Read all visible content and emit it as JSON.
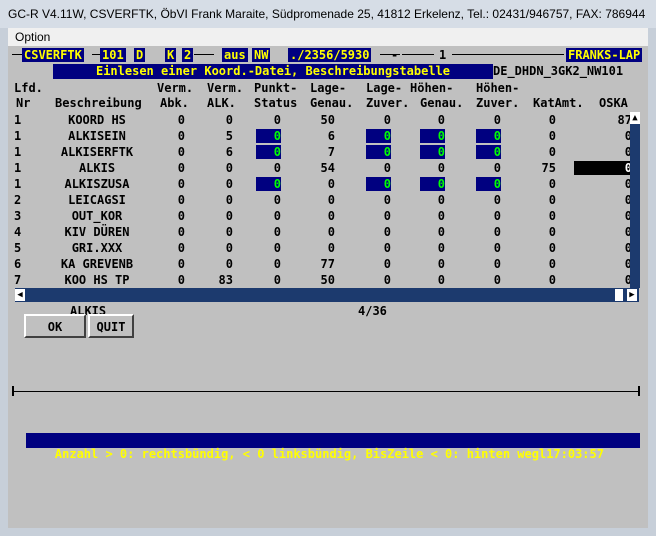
{
  "window": {
    "title": "GC-R V4.11W, CSVERFTK, ÖbVI Frank Maraite, Südpromenade 25, 41812 Erkelenz, Tel.: 02431/946757, FAX: 786944"
  },
  "menu": {
    "option": "Option"
  },
  "topbar": {
    "prog": "CSVERFTK",
    "num": "101",
    "flag1": "D",
    "flag2": "K",
    "flag3": "2",
    "mode": "aus",
    "region": "NW",
    "ref": "./2356/5930",
    "dash": "-",
    "page": "1",
    "user": "FRANKS-LAP"
  },
  "banner": {
    "title": "Einlesen einer Koord.-Datei, Beschreibungstabelle",
    "file": "DE_DHDN_3GK2_NW101"
  },
  "table": {
    "headers_line1": [
      "Lfd.",
      "",
      "Verm.",
      "Verm.",
      "Punkt-",
      "Lage-",
      "Lage-",
      "Höhen-",
      "Höhen-",
      "",
      ""
    ],
    "headers_line2": [
      "Nr",
      "Beschreibung",
      "Abk.",
      "ALK.",
      "Status",
      "Genau.",
      "Zuver.",
      "Genau.",
      "Zuver.",
      "KatAmt.",
      "OSKA"
    ],
    "rows": [
      {
        "nr": "1",
        "desc": "KOORD HS",
        "c": [
          "0",
          "0",
          "0",
          "50",
          "0",
          "0",
          "0",
          "0",
          "87"
        ]
      },
      {
        "nr": "1",
        "desc": "ALKISEIN",
        "c": [
          "0",
          "5",
          "0",
          "6",
          "0",
          "0",
          "0",
          "0",
          "0"
        ]
      },
      {
        "nr": "1",
        "desc": "ALKISERFTK",
        "c": [
          "0",
          "6",
          "0",
          "7",
          "0",
          "0",
          "0",
          "0",
          "0"
        ]
      },
      {
        "nr": "1",
        "desc": "ALKIS",
        "c": [
          "0",
          "0",
          "0",
          "54",
          "0",
          "0",
          "0",
          "75",
          "0"
        ]
      },
      {
        "nr": "1",
        "desc": "ALKISZUSA",
        "c": [
          "0",
          "0",
          "0",
          "0",
          "0",
          "0",
          "0",
          "0",
          "0"
        ]
      },
      {
        "nr": "2",
        "desc": "LEICAGSI",
        "c": [
          "0",
          "0",
          "0",
          "0",
          "0",
          "0",
          "0",
          "0",
          "0"
        ]
      },
      {
        "nr": "3",
        "desc": "OUT_KOR",
        "c": [
          "0",
          "0",
          "0",
          "0",
          "0",
          "0",
          "0",
          "0",
          "0"
        ]
      },
      {
        "nr": "4",
        "desc": "KIV DÜREN",
        "c": [
          "0",
          "0",
          "0",
          "0",
          "0",
          "0",
          "0",
          "0",
          "0"
        ]
      },
      {
        "nr": "5",
        "desc": "GRI.XXX",
        "c": [
          "0",
          "0",
          "0",
          "0",
          "0",
          "0",
          "0",
          "0",
          "0"
        ]
      },
      {
        "nr": "6",
        "desc": "KA GREVENB",
        "c": [
          "0",
          "0",
          "0",
          "77",
          "0",
          "0",
          "0",
          "0",
          "0"
        ]
      },
      {
        "nr": "7",
        "desc": "KOO HS TP",
        "c": [
          "0",
          "83",
          "0",
          "50",
          "0",
          "0",
          "0",
          "0",
          "0"
        ]
      }
    ]
  },
  "selection": {
    "name": "ALKIS",
    "position": "4/36"
  },
  "buttons": {
    "ok": "OK",
    "quit": "QUIT"
  },
  "status": {
    "message": "Anzahl > 0: rechtsbündig, < 0 linksbündig, BisZeile < 0: hinten wegl",
    "time": "17:03:57"
  },
  "colors": {
    "field_bg": "#000080",
    "field_fg": "#ffff00",
    "highlight_fg": "#00ff00",
    "window_bg": "#c0c0c0"
  }
}
